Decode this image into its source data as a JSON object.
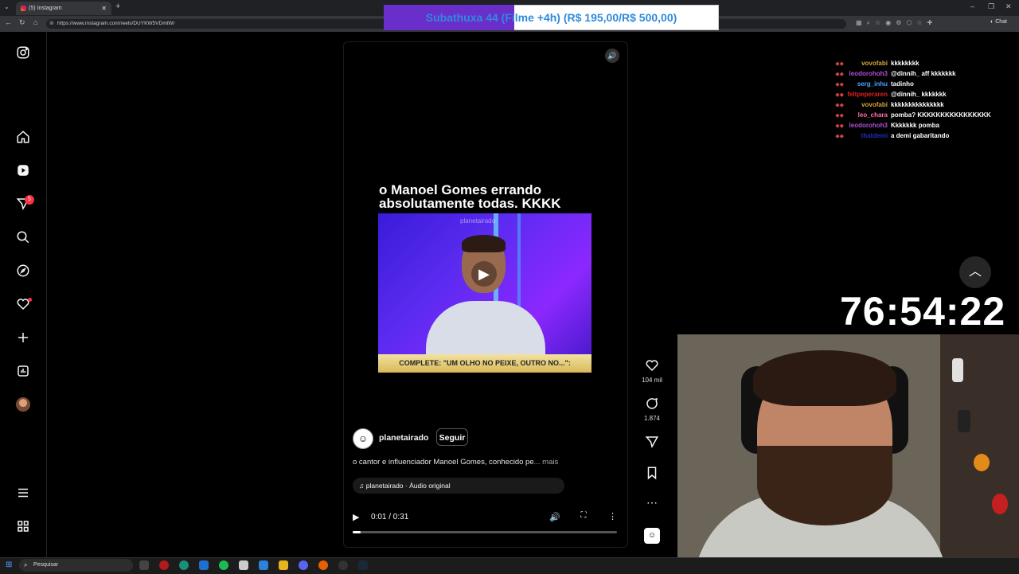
{
  "browser": {
    "tab_title": "(5) Instagram",
    "url": "https://www.instagram.com/reels/DUYKW5VDmtW/",
    "chat_button": "Chat"
  },
  "alert_banner": {
    "text": "Subathuxa 44 (Filme +4h) (R$ 195,00/R$ 500,00)",
    "progress": 0.39
  },
  "sidebar": {
    "notifications_badge": "5"
  },
  "reel": {
    "overlay_text": "o Manoel Gomes errando absolutamente todas. KKKK",
    "watermark": "planetairado",
    "lower_third": "COMPLETE: \"UM OLHO NO PEIXE, OUTRO NO...\":",
    "author": "planetairado",
    "follow_label": "Seguir",
    "description": "o cantor e influenciador Manoel Gomes, conhecido pe",
    "more_label": "... mais",
    "audio": "planetairado · Áudio original",
    "time": "0:01 / 0:31",
    "progress": 0.03
  },
  "actions": {
    "likes": "104 mil",
    "comments": "1.874"
  },
  "chat": [
    {
      "user": "vovofabi",
      "text": "kkkkkkkk",
      "color": "#d9a53a"
    },
    {
      "user": "leodorohoh3",
      "text": "@dinnih_ aff kkkkkkk",
      "color": "#b04fd8"
    },
    {
      "user": "serg_inhu",
      "text": "tadinho",
      "color": "#4aa3ff"
    },
    {
      "user": "feltpeperaren",
      "text": "@dinnih_ kkkkkkk",
      "color": "#e02020"
    },
    {
      "user": "vovofabi",
      "text": "kkkkkkkkkkkkkkk",
      "color": "#d9a53a"
    },
    {
      "user": "leo_chara",
      "text": "pomba? KKKKKKKKKKKKKKKK",
      "color": "#ff6fa8"
    },
    {
      "user": "leodorohoh3",
      "text": "Kkkkkkk pomba",
      "color": "#b04fd8"
    },
    {
      "user": "thatdemi",
      "text": "a demi gabaritando",
      "color": "#1e2fb8"
    }
  ],
  "timer": "76:54:22",
  "taskbar": {
    "search_placeholder": "Pesquisar"
  }
}
